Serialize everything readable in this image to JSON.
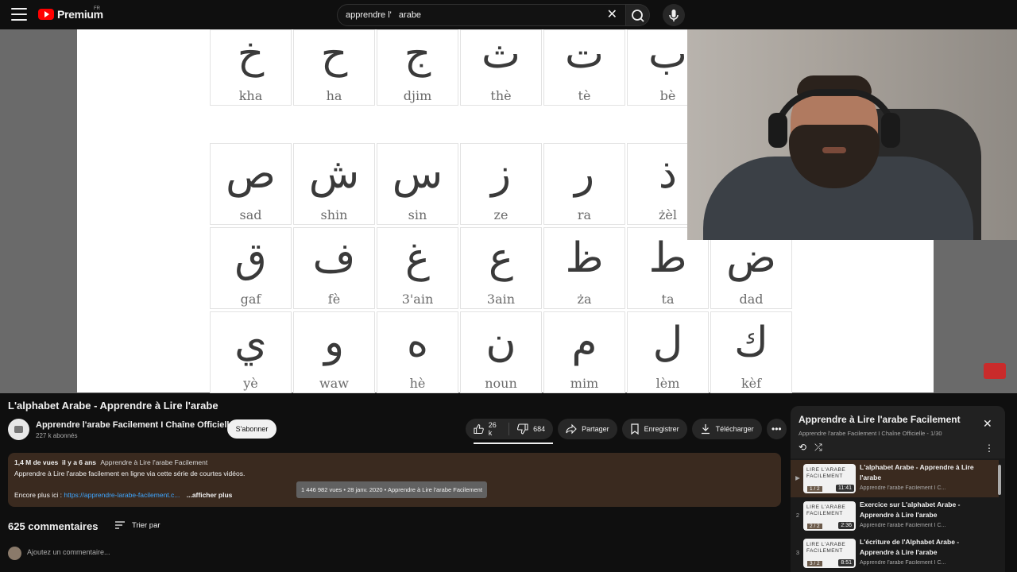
{
  "header": {
    "logo_text": "Premium",
    "logo_region": "FR",
    "search_value": "apprendre l'   arabe"
  },
  "slide": {
    "letters": [
      {
        "ar": "خ",
        "lat": "kha"
      },
      {
        "ar": "ح",
        "lat": "ha"
      },
      {
        "ar": "ج",
        "lat": "djim"
      },
      {
        "ar": "ث",
        "lat": "thè"
      },
      {
        "ar": "ت",
        "lat": "tè"
      },
      {
        "ar": "ب",
        "lat": "bè"
      },
      {
        "ar": "ص",
        "lat": "sad"
      },
      {
        "ar": "ش",
        "lat": "shin"
      },
      {
        "ar": "س",
        "lat": "sin"
      },
      {
        "ar": "ز",
        "lat": "ze"
      },
      {
        "ar": "ر",
        "lat": "ra"
      },
      {
        "ar": "ذ",
        "lat": "żèl"
      },
      {
        "ar": "ق",
        "lat": "gaf"
      },
      {
        "ar": "ف",
        "lat": "fè"
      },
      {
        "ar": "غ",
        "lat": "3'ain"
      },
      {
        "ar": "ع",
        "lat": "3ain"
      },
      {
        "ar": "ظ",
        "lat": "ża"
      },
      {
        "ar": "ط",
        "lat": "ta"
      },
      {
        "ar": "ض",
        "lat": "dad"
      },
      {
        "ar": "ي",
        "lat": "yè"
      },
      {
        "ar": "و",
        "lat": "waw"
      },
      {
        "ar": "ه",
        "lat": "hè"
      },
      {
        "ar": "ن",
        "lat": "noun"
      },
      {
        "ar": "م",
        "lat": "mim"
      },
      {
        "ar": "ل",
        "lat": "lèm"
      },
      {
        "ar": "ك",
        "lat": "kèf"
      }
    ]
  },
  "video": {
    "title": "L'alphabet Arabe - Apprendre à Lire l'arabe",
    "channel_name": "Apprendre l'arabe Facilement I Chaîne Officielle",
    "subscribers": "227 k abonnés",
    "subscribe_label": "S'abonner",
    "likes": "26 k",
    "dislikes": "684",
    "share_label": "Partager",
    "save_label": "Enregistrer",
    "download_label": "Télécharger"
  },
  "description": {
    "views": "1,4 M de vues",
    "age": "il y a 6 ans",
    "tag": "Apprendre à Lire l'arabe Facilement",
    "line2": "Apprendre à Lire l'arabe facilement en ligne via cette série de courtes vidéos.",
    "line3_prefix": "Encore plus ici :",
    "link": "https://apprendre-larabe-facilement.c...",
    "more_label": "...afficher plus",
    "tooltip": "1 446 982 vues • 28 janv. 2020 • Apprendre à Lire l'arabe Facilement"
  },
  "comments": {
    "count_label": "625 commentaires",
    "sort_label": "Trier par",
    "input_placeholder": "Ajoutez un commentaire..."
  },
  "playlist": {
    "title": "Apprendre à Lire l'arabe Facilement",
    "subtitle": "Apprendre l'arabe Facilement I Chaîne Officielle - 1/30",
    "items": [
      {
        "index": "▶",
        "title": "L'alphabet Arabe - Apprendre à Lire l'arabe",
        "channel": "Apprendre l'arabe Facilement I C...",
        "duration": "11:41",
        "thumb_text": "LIRE L'ARABE FACILEMENT",
        "ep": "1 / 2"
      },
      {
        "index": "2",
        "title": "Exercice sur L'alphabet Arabe - Apprendre à Lire l'arabe",
        "channel": "Apprendre l'arabe Facilement I C...",
        "duration": "2:36",
        "thumb_text": "LIRE L'ARABE FACILEMENT",
        "ep": "2 / 2"
      },
      {
        "index": "3",
        "title": "L'écriture de l'Alphabet Arabe - Apprendre à Lire l'arabe",
        "channel": "Apprendre l'arabe Facilement I C...",
        "duration": "8:51",
        "thumb_text": "LIRE L'ARABE FACILEMENT",
        "ep": "3 / 2"
      }
    ]
  }
}
